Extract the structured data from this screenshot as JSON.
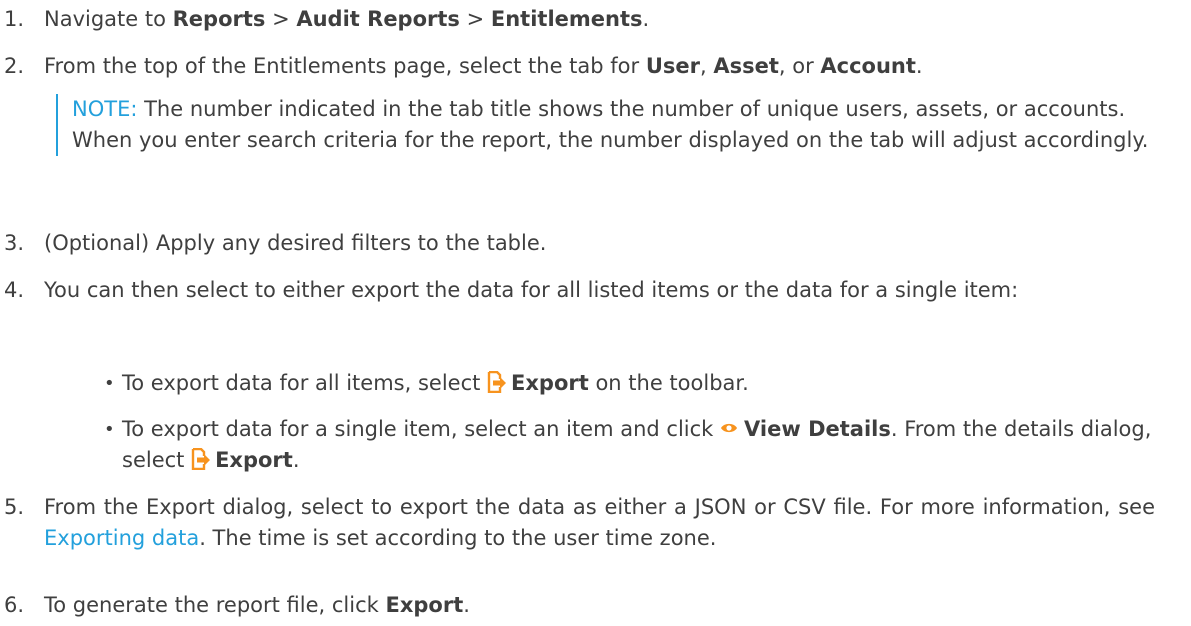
{
  "steps": [
    {
      "num": "1.",
      "pre": "Navigate to ",
      "b1": "Reports",
      "s1": " > ",
      "b2": "Audit Reports",
      "s2": " > ",
      "b3": "Entitlements",
      "post": "."
    },
    {
      "num": "2.",
      "pre": "From the top of the Entitlements page, select the tab for ",
      "b1": "User",
      "s1": ", ",
      "b2": "Asset",
      "s2": ", or ",
      "b3": "Account",
      "post": "."
    },
    {
      "num": "3.",
      "text": "(Optional) Apply any desired filters to the table."
    },
    {
      "num": "4.",
      "text": "You can then select to either export the data for all listed items or the data for a single item:"
    },
    {
      "num": "5.",
      "pre": "From the Export dialog, select to export the data as either a JSON or CSV file. For more information, see ",
      "link": "Exporting data",
      "post": ". The time is set according to the user time zone."
    },
    {
      "num": "6.",
      "pre": "To generate the report file, click ",
      "b1": "Export",
      "post": "."
    }
  ],
  "note": {
    "label": "NOTE:",
    "text": " The number indicated in the tab title shows the number of unique users, assets, or accounts. When you enter search criteria for the report, the number displayed on the tab will adjust accordingly."
  },
  "bullets": [
    {
      "pre": "To export data for all items, select ",
      "b1": "Export",
      "post": " on the toolbar."
    },
    {
      "pre": "To export data for a single item, select an item and click ",
      "b1": "View Details",
      "mid": ". From the details dialog, select ",
      "b2": "Export",
      "post": "."
    }
  ],
  "bullet_glyph": "•",
  "icons": {
    "export": "export-icon",
    "view": "eye-icon"
  },
  "colors": {
    "accent": "#23a0dc",
    "icon_orange": "#f7931e",
    "text": "#3f3f3f"
  }
}
